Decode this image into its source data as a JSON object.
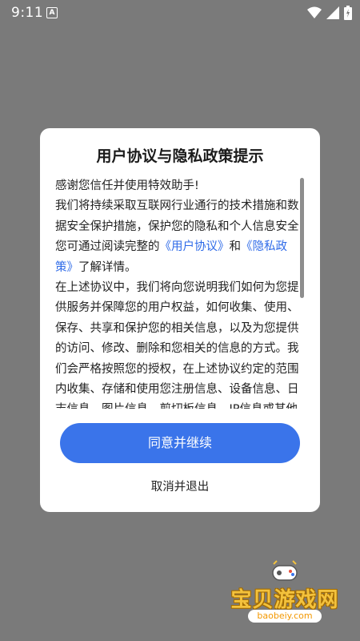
{
  "status_bar": {
    "time": "9:11",
    "notification_letter": "A",
    "icons": [
      "wifi-icon",
      "signal-icon",
      "battery-icon"
    ]
  },
  "dialog": {
    "title": "用户协议与隐私政策提示",
    "p1": "感谢您信任并使用特效助手!",
    "p2_before": "我们将持续采取互联网行业通行的技术措施和数据安全保护措施，保护您的隐私和个人信息安全您可通过阅读完整的",
    "link_user_agreement": "《用户协议》",
    "p2_and": "和",
    "link_privacy_policy": "《隐私政策》",
    "p2_after": "了解详情。",
    "p3": "在上述协议中，我们将向您说明我们如何为您提供服务并保障您的用户权益，如何收集、使用、保存、共享和保护您的相关信息，以及为您提供的访问、修改、删除和您相关的信息的方式。我们会严格按照您的授权，在上述协议约定的范围内收集、存储和使用您注册信息、设备信息、日志信息、图片信息、剪切板信息、IP信息或其他经您授权的信",
    "agree_label": "同意并继续",
    "cancel_label": "取消并退出"
  },
  "watermark": {
    "text": "宝贝游戏网",
    "url": "baobeiy.com"
  },
  "colors": {
    "overlay": "#7a7a7a",
    "accent": "#3a74ea",
    "link": "#2f6be8",
    "watermark": "#f3c23d"
  }
}
